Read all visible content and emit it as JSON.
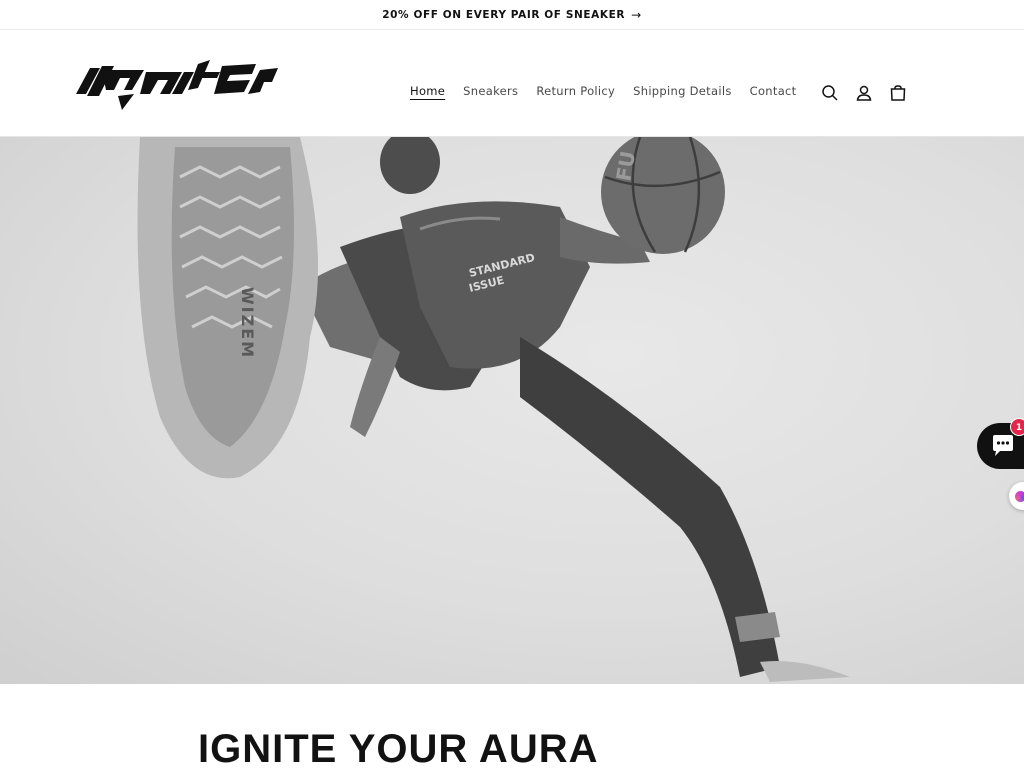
{
  "announcement": {
    "text": "20% OFF ON EVERY PAIR OF SNEAKER",
    "arrow_icon": "arrow-right-icon"
  },
  "header": {
    "logo_text": "ignite",
    "nav": [
      {
        "label": "Home",
        "active": true
      },
      {
        "label": "Sneakers"
      },
      {
        "label": "Return Policy"
      },
      {
        "label": "Shipping Details"
      },
      {
        "label": "Contact"
      }
    ],
    "icons": [
      "search-icon",
      "account-icon",
      "cart-icon"
    ]
  },
  "hero": {
    "image": "basketball-player-jump-shot",
    "shoe_text": "WIZEM",
    "ball_text": "FU",
    "jersey_lines": [
      "STANDARD",
      "ISSUE"
    ]
  },
  "main": {
    "heading": "IGNITE YOUR AURA"
  },
  "widgets": {
    "chat_badge": "1",
    "chat_icon": "chat-bubble-icon",
    "reward_icon": "rewards-icon"
  },
  "colors": {
    "text": "#121212",
    "badge": "#e3254a",
    "hero_bg": "#dedede"
  }
}
